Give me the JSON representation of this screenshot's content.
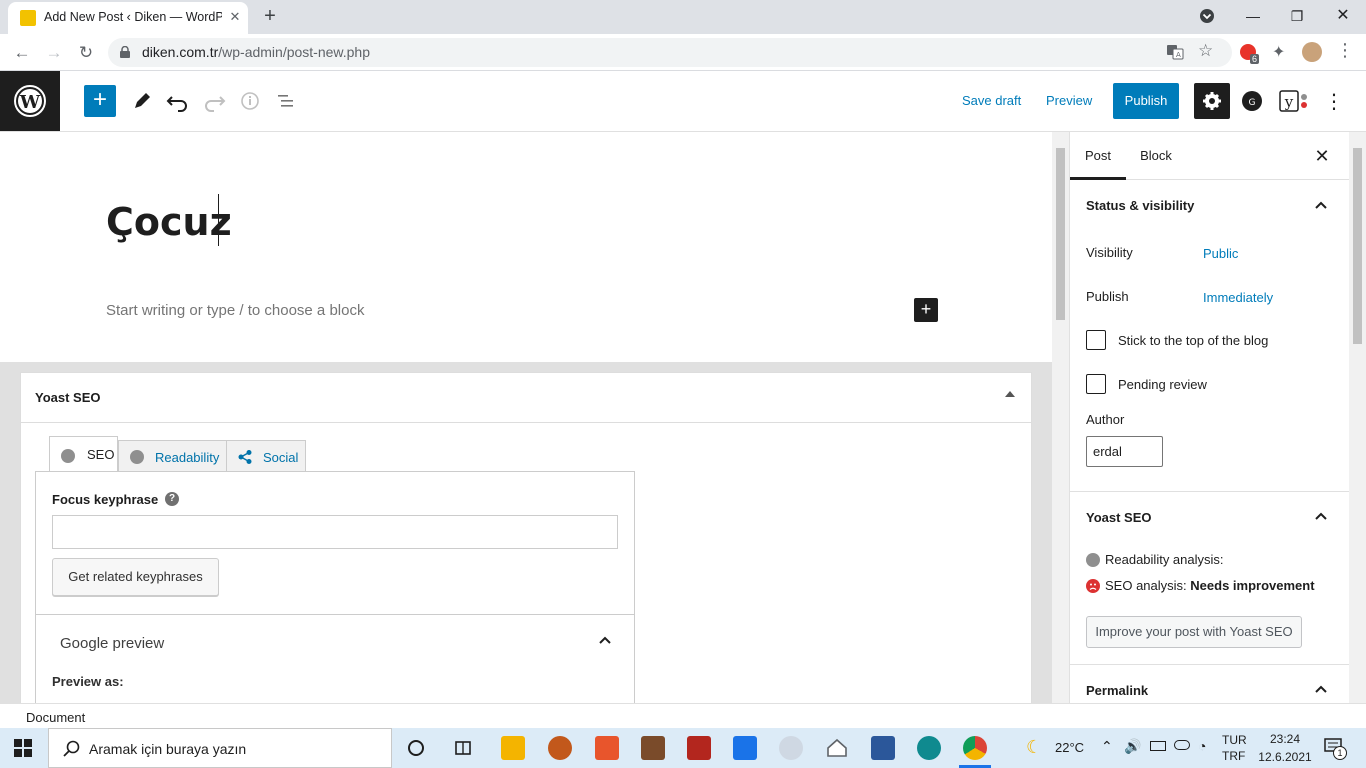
{
  "browser": {
    "tab_title": "Add New Post ‹ Diken — WordPr",
    "url_domain": "diken.com.tr",
    "url_path": "/wp-admin/post-new.php",
    "extension_badge": "6"
  },
  "toolbar": {
    "save_draft": "Save draft",
    "preview": "Preview",
    "publish": "Publish"
  },
  "editor": {
    "post_title": "Çocuz",
    "block_placeholder": "Start writing or type / to choose a block"
  },
  "yoast": {
    "box_title": "Yoast SEO",
    "tabs": [
      {
        "label": "SEO"
      },
      {
        "label": "Readability"
      },
      {
        "label": "Social"
      }
    ],
    "focus_keyphrase_label": "Focus keyphrase",
    "focus_keyphrase_value": "",
    "related_button": "Get related keyphrases",
    "google_preview_title": "Google preview",
    "preview_as_label": "Preview as:"
  },
  "sidebar": {
    "tabs": [
      "Post",
      "Block"
    ],
    "status_panel_title": "Status & visibility",
    "visibility_label": "Visibility",
    "visibility_value": "Public",
    "publish_label": "Publish",
    "publish_value": "Immediately",
    "stick_label": "Stick to the top of the blog",
    "pending_label": "Pending review",
    "author_label": "Author",
    "author_value": "erdal",
    "yoast_panel_title": "Yoast SEO",
    "readability_analysis": "Readability analysis:",
    "seo_analysis_label": "SEO analysis:",
    "seo_analysis_value": "Needs improvement",
    "improve_button": "Improve your post with Yoast SEO",
    "permalink_title": "Permalink"
  },
  "footer": {
    "breadcrumb": "Document"
  },
  "taskbar": {
    "search_placeholder": "Aramak için buraya yazın",
    "temperature": "22°C",
    "lang_line1": "TUR",
    "lang_line2": "TRF",
    "time": "23:24",
    "date": "12.6.2021",
    "notification_count": "1"
  },
  "colors": {
    "wp_blue": "#007cba",
    "dark": "#1e1e1e",
    "yoast_red": "#dc3232"
  }
}
